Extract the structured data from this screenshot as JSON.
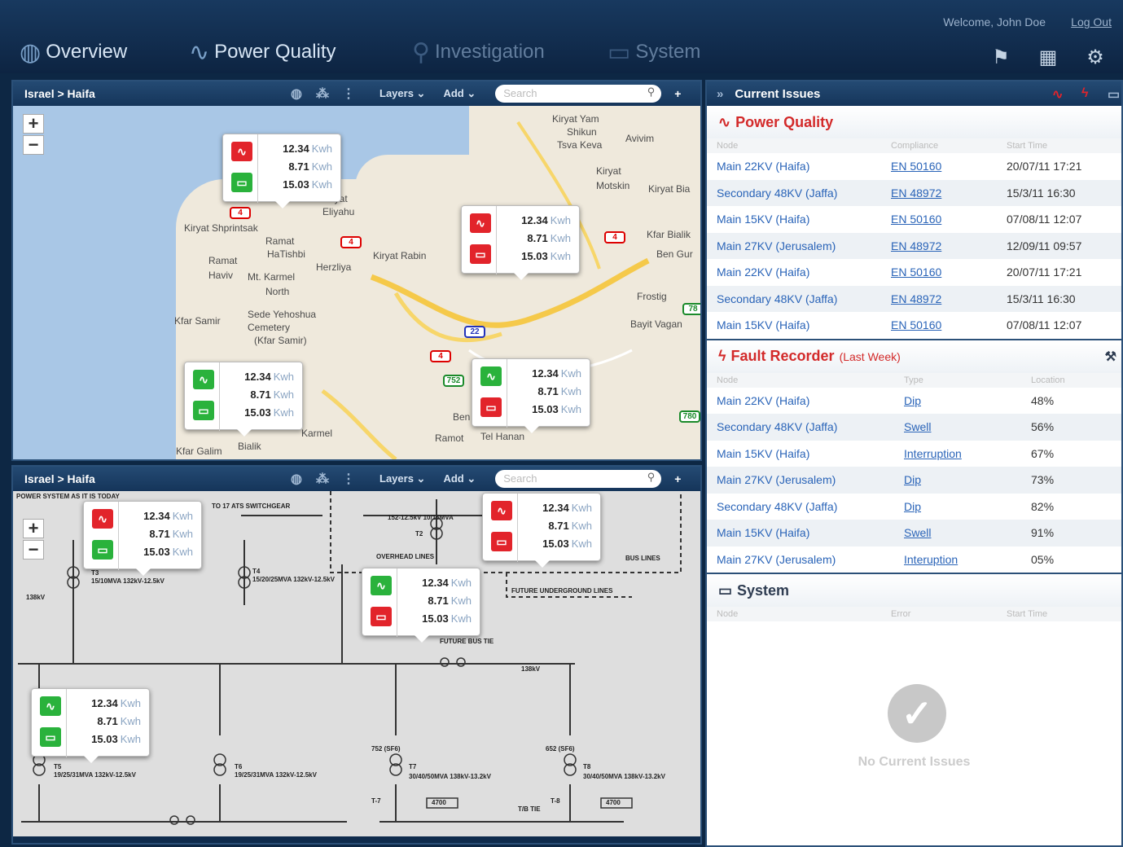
{
  "header": {
    "welcome": "Welcome, John Doe",
    "logout": "Log Out",
    "tabs": [
      "Overview",
      "Power Quality",
      "Investigation",
      "System"
    ]
  },
  "map_panel": {
    "breadcrumb": "Israel > Haifa",
    "layers": "Layers",
    "add": "Add",
    "search_placeholder": "Search",
    "zoom_in": "+",
    "zoom_out": "−",
    "labels": [
      "Kiryat Yam",
      "Shikun",
      "Tsva Keva",
      "Avivim",
      "Kiryat",
      "Motskin",
      "Kiryat Bia",
      "Kfar Bialik",
      "Ben Gur",
      "Frostig",
      "Bayit Vagan",
      "Kiryat",
      "Eliyahu",
      "Kiryat Shprintsak",
      "Ramat",
      "HaTishbi",
      "Ramat",
      "Haviv",
      "Mt. Karmel",
      "North",
      "Herzliya",
      "Kiryat Rabin",
      "Kfar Samir",
      "Sede Yehoshua",
      "Cemetery",
      "(Kfar Samir)",
      "Karmel",
      "Ramot",
      "Tel Hanan",
      "Kfar Galim",
      "Bialik",
      "Ben"
    ],
    "road_numbers": [
      "4",
      "4",
      "4",
      "4",
      "22",
      "752",
      "78",
      "780"
    ]
  },
  "schema_panel": {
    "breadcrumb": "Israel > Haifa",
    "layers": "Layers",
    "add": "Add",
    "search_placeholder": "Search",
    "zoom_in": "+",
    "zoom_out": "−",
    "labels": [
      "POWER SYSTEM AS IT IS TODAY",
      "TO 17 ATS SWITCHGEAR",
      "138kV",
      "T3",
      "15/10MVA 132kV-12.5kV",
      "T4",
      "15/20/25MVA 132kV-12.5kV",
      "152-12.5kV 10/15MVA",
      "T2",
      "OVERHEAD LINES",
      "BUS LINES",
      "FUTURE UNDERGROUND LINES",
      "FUTURE BUS TIE",
      "138kV",
      "T5",
      "19/25/31MVA 132kV-12.5kV",
      "T6",
      "19/25/31MVA 132kV-12.5kV",
      "752 (SF6)",
      "T7",
      "30/40/50MVA 138kV-13.2kV",
      "4700",
      "652 (SF6)",
      "T8",
      "30/40/50MVA 138kV-13.2kV",
      "4700",
      "T-7",
      "T-8",
      "T/B TIE"
    ]
  },
  "callout": {
    "v1": "12.34",
    "v2": "8.71",
    "v3": "15.03",
    "unit": "Kwh"
  },
  "issues": {
    "title": "Current Issues",
    "power_quality": {
      "title": "Power Quality",
      "cols": [
        "Node",
        "Compliance",
        "Start Time"
      ],
      "rows": [
        [
          "Main 22KV (Haifa)",
          "EN 50160",
          "20/07/11 17:21"
        ],
        [
          "Secondary 48KV (Jaffa)",
          "EN 48972",
          "15/3/11 16:30"
        ],
        [
          "Main 15KV (Haifa)",
          "EN 50160",
          "07/08/11 12:07"
        ],
        [
          "Main 27KV (Jerusalem)",
          "EN 48972",
          "12/09/11 09:57"
        ],
        [
          "Main 22KV (Haifa)",
          "EN 50160",
          "20/07/11 17:21"
        ],
        [
          "Secondary 48KV (Jaffa)",
          "EN 48972",
          "15/3/11 16:30"
        ],
        [
          "Main 15KV (Haifa)",
          "EN 50160",
          "07/08/11 12:07"
        ]
      ]
    },
    "fault_recorder": {
      "title": "Fault Recorder",
      "subtitle": "(Last Week)",
      "cols": [
        "Node",
        "Type",
        "Location"
      ],
      "rows": [
        [
          "Main 22KV (Haifa)",
          "Dip",
          "48%"
        ],
        [
          "Secondary 48KV (Jaffa)",
          "Swell",
          "56%"
        ],
        [
          "Main 15KV (Haifa)",
          "Interruption",
          "67%"
        ],
        [
          "Main 27KV (Jerusalem)",
          "Dip",
          "73%"
        ],
        [
          "Secondary 48KV (Jaffa)",
          "Dip",
          "82%"
        ],
        [
          "Main 15KV (Haifa)",
          "Swell",
          "91%"
        ],
        [
          "Main 27KV (Jerusalem)",
          "Interuption",
          "05%"
        ]
      ]
    },
    "system": {
      "title": "System",
      "cols": [
        "Node",
        "Error",
        "Start Time"
      ],
      "empty": "No Current Issues"
    }
  },
  "colors": {
    "red": "#e2242b",
    "green": "#2ab23c",
    "link": "#2a64b8",
    "nav": "#0d2744"
  },
  "icons": [
    "globe-icon",
    "network-icon",
    "dots-icon",
    "search-icon",
    "plus-icon",
    "person-icon",
    "calendar-icon",
    "gear-icon",
    "pulse-icon",
    "lightning-icon",
    "monitor-icon",
    "wrench-icon",
    "checkmark-icon"
  ]
}
